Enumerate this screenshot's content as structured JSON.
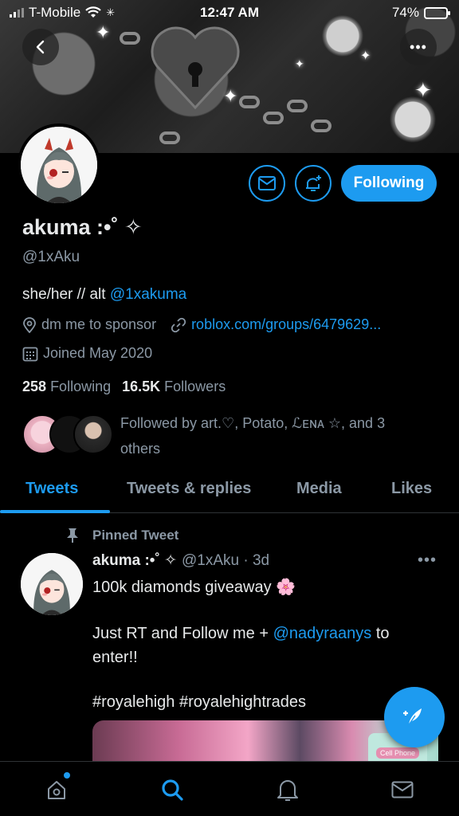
{
  "status_bar": {
    "carrier": "T-Mobile",
    "time": "12:47 AM",
    "battery": "74%",
    "battery_level": 0.74
  },
  "profile": {
    "name": "akuma :•˚ ✧",
    "handle": "@1xAku",
    "bio_prefix": "she/her // alt ",
    "bio_link": "@1xakuma",
    "location": "dm me to sponsor",
    "website": "roblox.com/groups/6479629...",
    "joined": "Joined May 2020",
    "following_count": "258",
    "following_label": "Following",
    "followers_count": "16.5K",
    "followers_label": "Followers",
    "followed_by_line1": "Followed by art.♡, Potato, ℒᴇɴᴀ ☆, and 3",
    "followed_by_line2": "others",
    "follow_button": "Following"
  },
  "tabs": [
    {
      "label": "Tweets",
      "active": true
    },
    {
      "label": "Tweets & replies",
      "active": false
    },
    {
      "label": "Media",
      "active": false
    },
    {
      "label": "Likes",
      "active": false
    }
  ],
  "tweet": {
    "pinned_label": "Pinned Tweet",
    "author": "akuma :•˚ ✧",
    "handle_time": "@1xAku · 3d",
    "line1": "100k diamonds giveaway 🌸",
    "line2_prefix": "Just RT and Follow me + ",
    "line2_mention": "@nadyraanys",
    "line2_suffix": " to",
    "line3": "enter!!",
    "hashtags": "#royalehigh #royalehightrades",
    "image_caption": "Cell Phone"
  },
  "icons": {
    "back": "chevron-left-icon",
    "more": "more-icon",
    "message": "mail-icon",
    "notify": "bell-plus-icon",
    "location": "location-pin-icon",
    "link": "link-icon",
    "calendar": "calendar-icon",
    "pin": "pin-icon",
    "compose": "compose-feather-icon",
    "nav": [
      "home-icon",
      "search-icon",
      "bell-icon",
      "mail-icon"
    ]
  },
  "colors": {
    "accent": "#1d9bf0",
    "muted": "#8b98a5",
    "text": "#e7e9ea",
    "background": "#000000"
  }
}
